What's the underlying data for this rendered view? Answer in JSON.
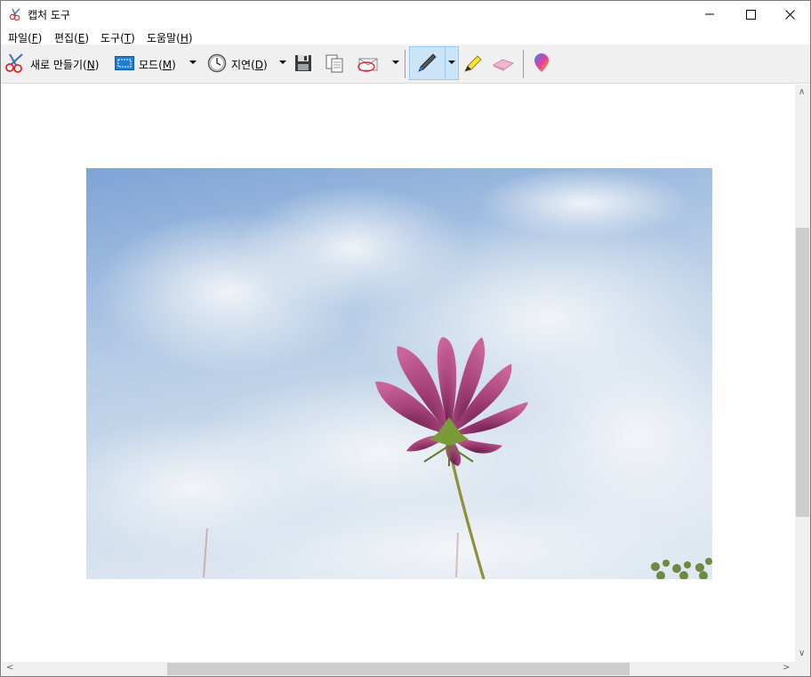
{
  "window": {
    "title": "캡처 도구",
    "controls": [
      "minimize-icon",
      "maximize-icon",
      "close-icon"
    ]
  },
  "menu": [
    {
      "label": "파일(",
      "key": "F",
      "end": ")"
    },
    {
      "label": "편집(",
      "key": "E",
      "end": ")"
    },
    {
      "label": "도구(",
      "key": "T",
      "end": ")"
    },
    {
      "label": "도움말(",
      "key": "H",
      "end": ")"
    }
  ],
  "toolbar": {
    "new_label": "새로 만들기(",
    "new_key": "N",
    "new_end": ")",
    "mode_label": "모드(",
    "mode_key": "M",
    "mode_end": ")",
    "delay_label": "지연(",
    "delay_key": "D",
    "delay_end": ")",
    "icons": [
      "scissors-icon",
      "rectangle-mode-icon",
      "clock-icon",
      "save-icon",
      "copy-icon",
      "send-email-icon",
      "pen-icon",
      "highlighter-icon",
      "eraser-icon",
      "paint3d-icon"
    ],
    "active_tool": "pen"
  },
  "capture": {
    "description_icon": "captured-image-flower"
  },
  "colors": {
    "accent": "#cce4f7",
    "toolbar_bg": "#f0f0f0",
    "scrollbar_thumb": "#cdcdcd"
  }
}
